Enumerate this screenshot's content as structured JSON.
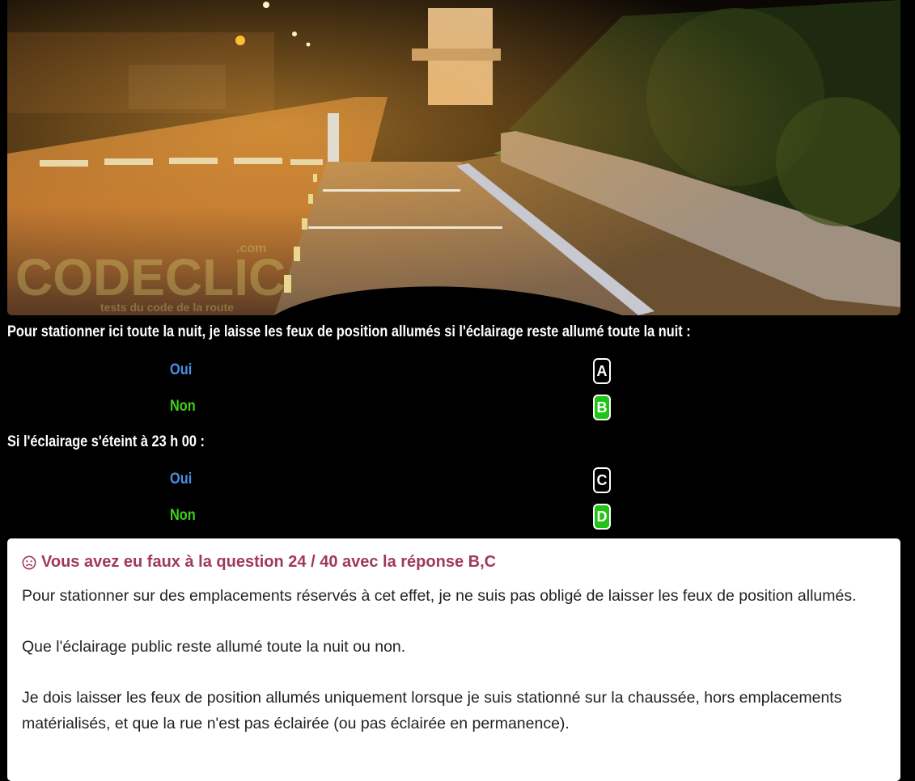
{
  "photo": {
    "alt_icon": "street-photo-image",
    "watermark": "CODECLIC",
    "watermark_domain": ".com",
    "watermark_tagline": "tests du code de la route"
  },
  "questions": [
    {
      "text": "Pour stationner ici toute la nuit, je laisse les feux de position allumés si l'éclairage reste allumé toute la nuit :",
      "answers": [
        {
          "label": "Oui",
          "key": "A",
          "selected": false
        },
        {
          "label": "Non",
          "key": "B",
          "selected": true
        }
      ]
    },
    {
      "text": "Si l'éclairage s'éteint à 23 h 00 :",
      "answers": [
        {
          "label": "Oui",
          "key": "C",
          "selected": false
        },
        {
          "label": "Non",
          "key": "D",
          "selected": true
        }
      ]
    }
  ],
  "result": {
    "icon": "sad-face-icon",
    "text": "Vous avez eu faux à la question 24 / 40 avec la réponse B,C"
  },
  "explanation": [
    "Pour stationner sur des emplacements réservés à cet effet, je ne suis pas obligé de laisser les feux de position allumés.",
    "Que l'éclairage public reste allumé toute la nuit ou non.",
    "Je dois laisser les feux de position allumés uniquement lorsque je suis stationné sur la chaussée, hors emplacements matérialisés, et que la rue n'est pas éclairée (ou pas éclairée en permanence)."
  ],
  "colors": {
    "answer_oui": "#4a90e2",
    "answer_non": "#3ecf1a",
    "selected_key": "#1fc414",
    "result_text": "#a0395a"
  }
}
